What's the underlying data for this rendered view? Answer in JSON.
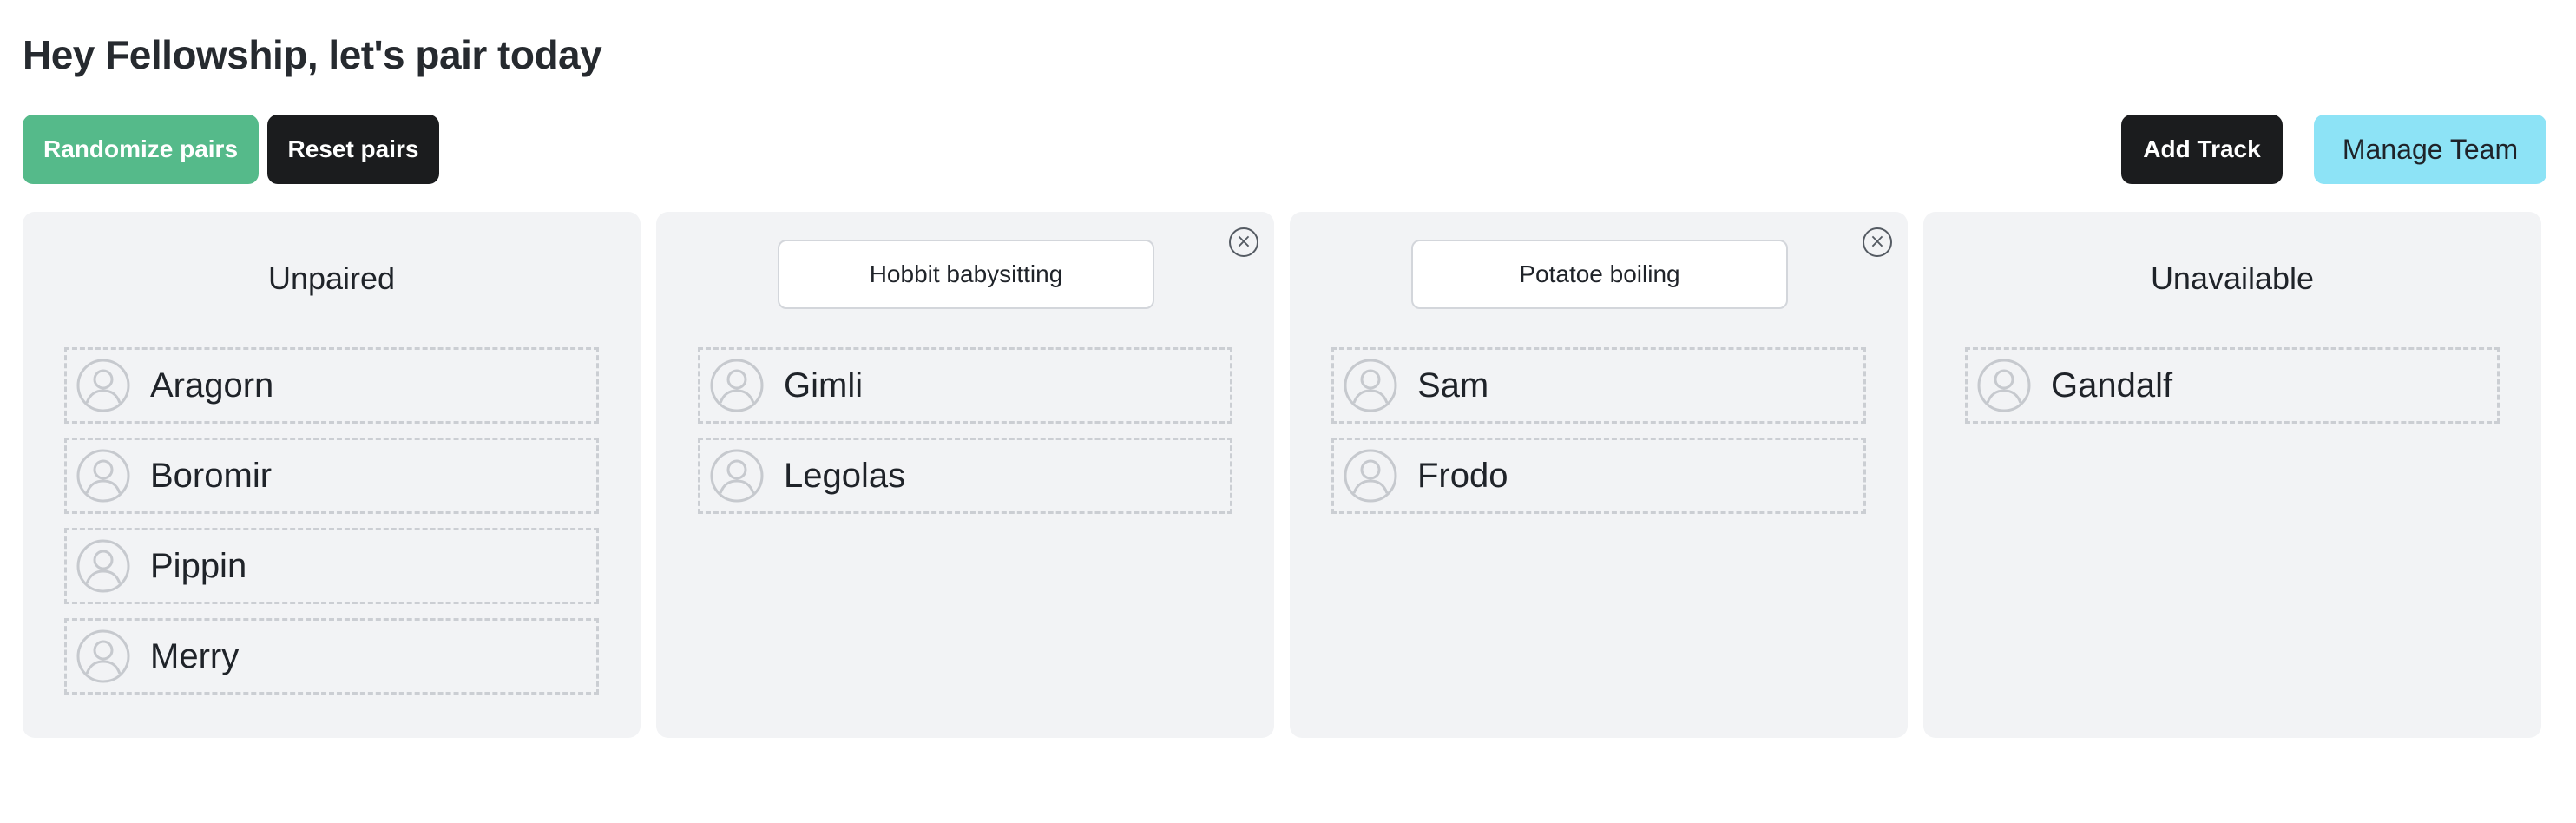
{
  "header": {
    "title": "Hey Fellowship, let's pair today"
  },
  "toolbar": {
    "randomize_label": "Randomize pairs",
    "reset_label": "Reset pairs",
    "add_track_label": "Add Track",
    "manage_team_label": "Manage Team"
  },
  "colors": {
    "randomize": "#55ba8a",
    "dark_button": "#1b1c1e",
    "manage_team": "#8de3f6",
    "column_bg": "#f2f3f5",
    "dashed_border": "#cbced3"
  },
  "icons": {
    "avatar": "user-circle-icon",
    "close": "close-circle-icon"
  },
  "columns": [
    {
      "kind": "static",
      "heading": "Unpaired",
      "people": [
        "Aragorn",
        "Boromir",
        "Pippin",
        "Merry"
      ]
    },
    {
      "kind": "track",
      "track_name": "Hobbit babysitting",
      "close_symbol": "×",
      "people": [
        "Gimli",
        "Legolas"
      ]
    },
    {
      "kind": "track",
      "track_name": "Potatoe boiling",
      "close_symbol": "×",
      "people": [
        "Sam",
        "Frodo"
      ]
    },
    {
      "kind": "static",
      "heading": "Unavailable",
      "people": [
        "Gandalf"
      ]
    }
  ]
}
